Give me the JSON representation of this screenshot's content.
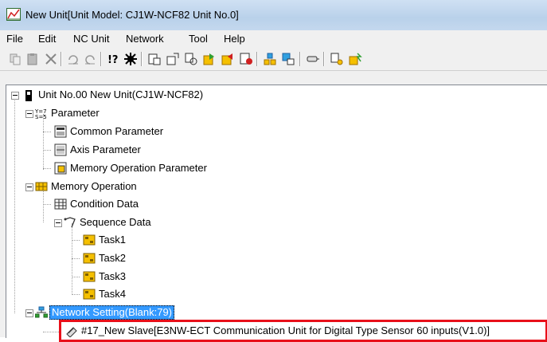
{
  "window": {
    "title": "New Unit[Unit Model: CJ1W-NCF82 Unit No.0]",
    "icon": "unit-chart-icon"
  },
  "menu": {
    "items": [
      {
        "label": "File"
      },
      {
        "label": "Edit"
      },
      {
        "label": "NC Unit"
      },
      {
        "label": "Network"
      },
      {
        "label": "Tool"
      },
      {
        "label": "Help"
      }
    ]
  },
  "toolbar": {
    "buttons": [
      "copy-icon",
      "paste-icon",
      "delete-icon",
      "undo-icon",
      "redo-icon",
      "help-icon",
      "settings-icon",
      "parameter-icon",
      "transfer-icon",
      "compare-icon",
      "download-icon",
      "upload-icon",
      "save-icon",
      "network-icon",
      "monitor-icon",
      "connect-icon",
      "tree-icon",
      "signal-icon"
    ]
  },
  "tree": {
    "root": "Unit No.00 New Unit(CJ1W-NCF82)",
    "parameter": "Parameter",
    "common_parameter": "Common Parameter",
    "axis_parameter": "Axis Parameter",
    "memory_operation_parameter": "Memory Operation Parameter",
    "memory_operation": "Memory Operation",
    "condition_data": "Condition Data",
    "sequence_data": "Sequence Data",
    "task1": "Task1",
    "task2": "Task2",
    "task3": "Task3",
    "task4": "Task4",
    "network_setting": "Network Setting(Blank:79)",
    "slave": "#17_New Slave[E3NW-ECT Communication Unit for Digital Type Sensor 60 inputs(V1.0)]"
  },
  "colors": {
    "selection": "#3399ff",
    "highlight_box": "#e8101a",
    "title_bar": "#b9d1ea"
  }
}
